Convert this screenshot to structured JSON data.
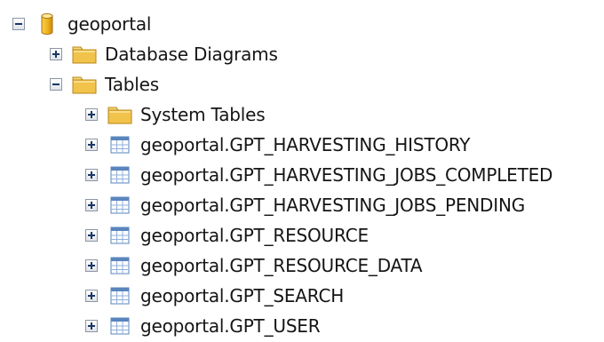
{
  "tree": {
    "root": {
      "label": "geoportal",
      "icon": "database-icon",
      "expanded": true,
      "children": [
        {
          "label": "Database Diagrams",
          "icon": "folder-icon",
          "expanded": false
        },
        {
          "label": "Tables",
          "icon": "folder-icon",
          "expanded": true,
          "children": [
            {
              "label": "System Tables",
              "icon": "folder-icon",
              "expanded": false
            },
            {
              "label": "geoportal.GPT_HARVESTING_HISTORY",
              "icon": "table-icon",
              "expanded": false
            },
            {
              "label": "geoportal.GPT_HARVESTING_JOBS_COMPLETED",
              "icon": "table-icon",
              "expanded": false
            },
            {
              "label": "geoportal.GPT_HARVESTING_JOBS_PENDING",
              "icon": "table-icon",
              "expanded": false
            },
            {
              "label": "geoportal.GPT_RESOURCE",
              "icon": "table-icon",
              "expanded": false
            },
            {
              "label": "geoportal.GPT_RESOURCE_DATA",
              "icon": "table-icon",
              "expanded": false
            },
            {
              "label": "geoportal.GPT_SEARCH",
              "icon": "table-icon",
              "expanded": false
            },
            {
              "label": "geoportal.GPT_USER",
              "icon": "table-icon",
              "expanded": false
            }
          ]
        }
      ]
    }
  },
  "colors": {
    "toggle_border": "#8c96a3",
    "toggle_sign": "#1b3766",
    "folder": "#f2c34b",
    "database": "#f0b21e",
    "table_header": "#5a85bd",
    "text": "#151515"
  }
}
